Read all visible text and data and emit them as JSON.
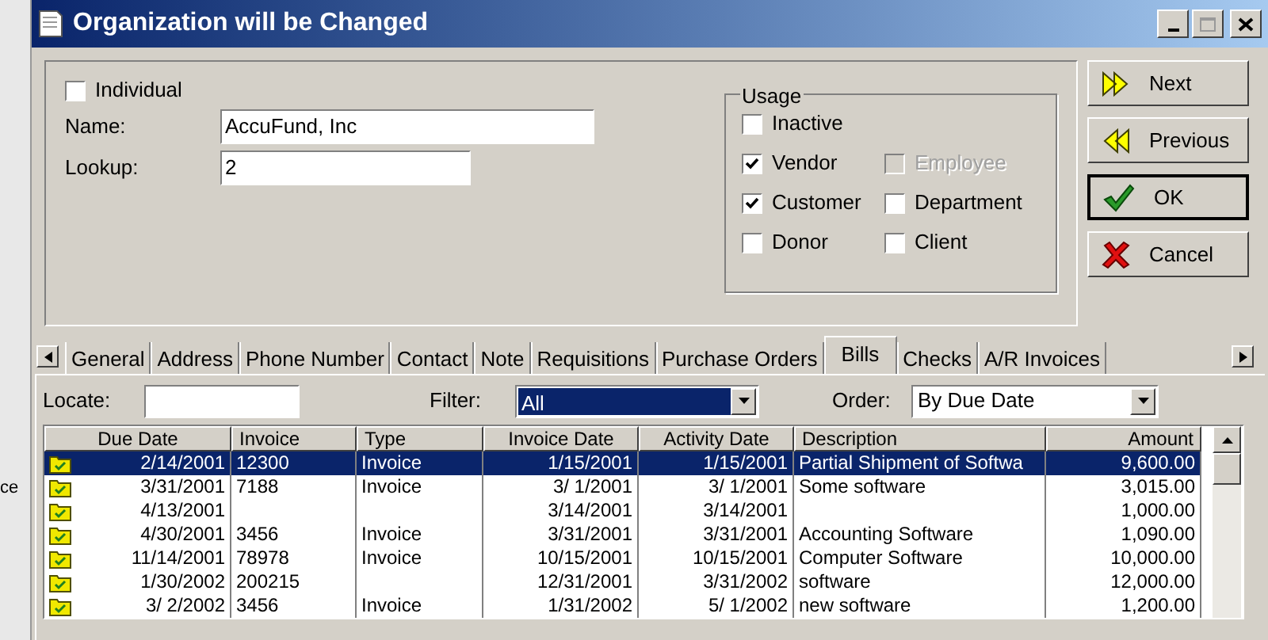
{
  "background_window": {
    "text": "ce"
  },
  "window": {
    "title": "Organization will be Changed"
  },
  "individual": {
    "label": "Individual",
    "checked": false
  },
  "fields": [
    {
      "label": "Name:",
      "value": "AccuFund, Inc"
    },
    {
      "label": "Lookup:",
      "value": "2"
    }
  ],
  "usage": {
    "title": "Usage",
    "options": [
      {
        "label": "Inactive",
        "checked": false,
        "disabled": false
      },
      {
        "label": "Vendor",
        "checked": true,
        "disabled": false
      },
      {
        "label": "Employee",
        "checked": false,
        "disabled": true
      },
      {
        "label": "Customer",
        "checked": true,
        "disabled": false
      },
      {
        "label": "Department",
        "checked": false,
        "disabled": false
      },
      {
        "label": "Donor",
        "checked": false,
        "disabled": false
      },
      {
        "label": "Client",
        "checked": false,
        "disabled": false
      }
    ]
  },
  "buttons": [
    {
      "label": "Next",
      "kind": "next"
    },
    {
      "label": "Previous",
      "kind": "previous"
    },
    {
      "label": "OK",
      "kind": "ok"
    },
    {
      "label": "Cancel",
      "kind": "cancel"
    }
  ],
  "tabs": [
    {
      "label": "General",
      "selected": false
    },
    {
      "label": "Address",
      "selected": false
    },
    {
      "label": "Phone Number",
      "selected": false
    },
    {
      "label": "Contact",
      "selected": false
    },
    {
      "label": "Note",
      "selected": false
    },
    {
      "label": "Requisitions",
      "selected": false
    },
    {
      "label": "Purchase Orders",
      "selected": false
    },
    {
      "label": "Bills",
      "selected": true
    },
    {
      "label": "Checks",
      "selected": false
    },
    {
      "label": "A/R Invoices",
      "selected": false
    }
  ],
  "locate": {
    "label": "Locate:"
  },
  "filter": {
    "label": "Filter:",
    "value": "All"
  },
  "order": {
    "label": "Order:",
    "value": "By Due Date"
  },
  "table": {
    "columns": [
      "Due Date",
      "Invoice",
      "Type",
      "Invoice Date",
      "Activity Date",
      "Description",
      "Amount"
    ],
    "rows": [
      {
        "selected": true,
        "cells": [
          "2/14/2001",
          "12300",
          "Invoice",
          "1/15/2001",
          "1/15/2001",
          "Partial Shipment of Softwa",
          "9,600.00"
        ]
      },
      {
        "selected": false,
        "cells": [
          "3/31/2001",
          "7188",
          "Invoice",
          "3/ 1/2001",
          "3/ 1/2001",
          "Some software",
          "3,015.00"
        ]
      },
      {
        "selected": false,
        "cells": [
          "4/13/2001",
          "",
          "",
          "3/14/2001",
          "3/14/2001",
          "",
          "1,000.00"
        ]
      },
      {
        "selected": false,
        "cells": [
          "4/30/2001",
          "3456",
          "Invoice",
          "3/31/2001",
          "3/31/2001",
          "Accounting Software",
          "1,090.00"
        ]
      },
      {
        "selected": false,
        "cells": [
          "11/14/2001",
          "78978",
          "Invoice",
          "10/15/2001",
          "10/15/2001",
          "Computer Software",
          "10,000.00"
        ]
      },
      {
        "selected": false,
        "cells": [
          "1/30/2002",
          "200215",
          "",
          "12/31/2001",
          "3/31/2002",
          "software",
          "12,000.00"
        ]
      },
      {
        "selected": false,
        "cells": [
          "3/ 2/2002",
          "3456",
          "Invoice",
          "1/31/2002",
          "5/ 1/2002",
          "new software",
          "1,200.00"
        ]
      }
    ]
  }
}
